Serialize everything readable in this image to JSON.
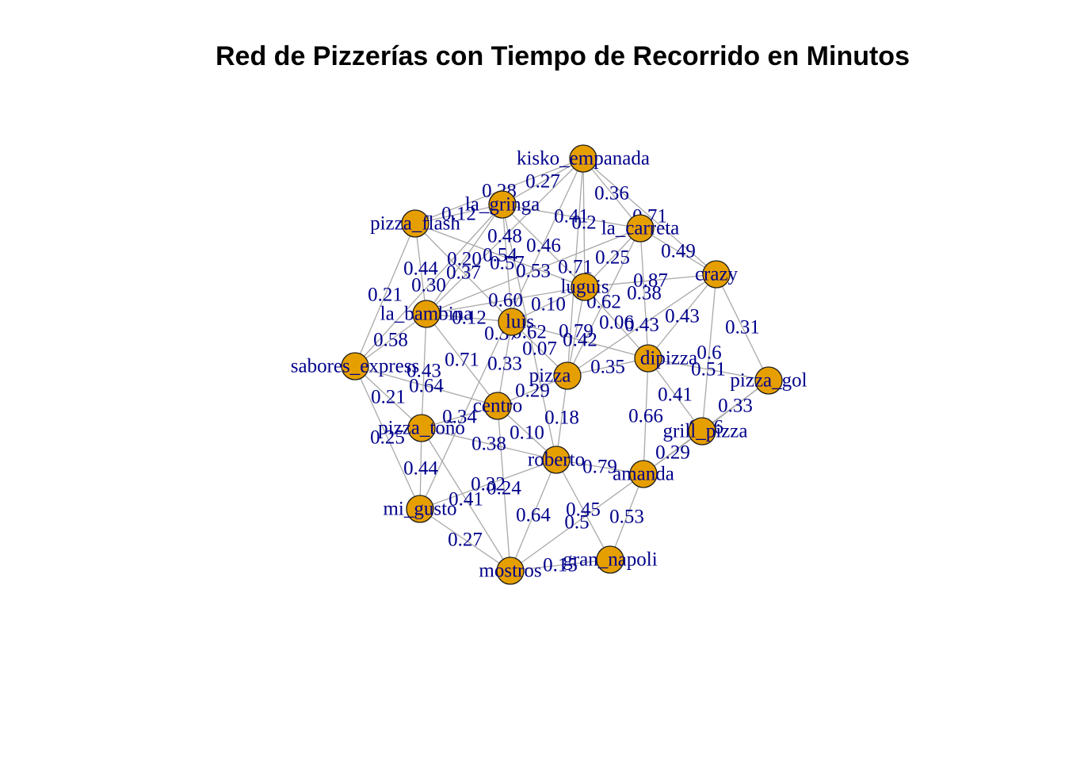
{
  "title": "Red de Pizzerías con Tiempo de Recorrido en Minutos",
  "colors": {
    "node_fill": "#e69f00",
    "edge": "#a9a9a9",
    "label": "#00008b"
  },
  "graph": {
    "nodes": [
      {
        "id": "kisko_empanada",
        "label": "kisko_empanada"
      },
      {
        "id": "la_gringa",
        "label": "la_gringa"
      },
      {
        "id": "la_carreta",
        "label": "la_carreta"
      },
      {
        "id": "pizza_flash",
        "label": "pizza_flash"
      },
      {
        "id": "crazy",
        "label": "crazy"
      },
      {
        "id": "luguis",
        "label": "luguis"
      },
      {
        "id": "la_bambina",
        "label": "la_bambina"
      },
      {
        "id": "luis",
        "label": "luis"
      },
      {
        "id": "sabores_express",
        "label": "sabores_express"
      },
      {
        "id": "dipizza",
        "label": "dipizza"
      },
      {
        "id": "pizza_center",
        "label": "pizza"
      },
      {
        "id": "pizza_gol",
        "label": "pizza_gol"
      },
      {
        "id": "centro",
        "label": "centro"
      },
      {
        "id": "pizza_toño",
        "label": "pizza_toño"
      },
      {
        "id": "grill_pizza",
        "label": "grill_pizza"
      },
      {
        "id": "roberto",
        "label": "roberto"
      },
      {
        "id": "amanda",
        "label": "amanda"
      },
      {
        "id": "mi_gusto",
        "label": "mi_gusto"
      },
      {
        "id": "gran_napoli",
        "label": "gran_napoli"
      },
      {
        "id": "mostros",
        "label": "mostros"
      }
    ],
    "edges": [
      {
        "from": "kisko_empanada",
        "to": "la_gringa",
        "weight": "0.27"
      },
      {
        "from": "kisko_empanada",
        "to": "pizza_flash",
        "weight": "0.28"
      },
      {
        "from": "kisko_empanada",
        "to": "luguis",
        "weight": "0.2"
      },
      {
        "from": "kisko_empanada",
        "to": "la_carreta",
        "weight": "0.36"
      },
      {
        "from": "kisko_empanada",
        "to": "la_bambina",
        "weight": "0.48"
      },
      {
        "from": "kisko_empanada",
        "to": "crazy",
        "weight": "0.71"
      },
      {
        "from": "kisko_empanada",
        "to": "pizza_center",
        "weight": "0.71"
      },
      {
        "from": "kisko_empanada",
        "to": "mi_gusto",
        "weight": "0.37"
      },
      {
        "from": "la_gringa",
        "to": "pizza_flash",
        "weight": "0.12"
      },
      {
        "from": "la_gringa",
        "to": "luguis",
        "weight": "0.46"
      },
      {
        "from": "la_gringa",
        "to": "la_carreta",
        "weight": "0.41"
      },
      {
        "from": "la_gringa",
        "to": "luis",
        "weight": "0.57"
      },
      {
        "from": "la_gringa",
        "to": "sabores_express",
        "weight": "0.30"
      },
      {
        "from": "la_gringa",
        "to": "la_bambina",
        "weight": "0.20"
      },
      {
        "from": "la_gringa",
        "to": "roberto",
        "weight": "0.62"
      },
      {
        "from": "la_carreta",
        "to": "crazy",
        "weight": "0.49"
      },
      {
        "from": "la_carreta",
        "to": "luguis",
        "weight": "0.25"
      },
      {
        "from": "la_carreta",
        "to": "dipizza",
        "weight": "0.38"
      },
      {
        "from": "la_carreta",
        "to": "pizza_center",
        "weight": "0.62"
      },
      {
        "from": "la_carreta",
        "to": "la_bambina",
        "weight": "0.53"
      },
      {
        "from": "pizza_flash",
        "to": "la_bambina",
        "weight": "0.44"
      },
      {
        "from": "pizza_flash",
        "to": "sabores_express",
        "weight": "0.21"
      },
      {
        "from": "pizza_flash",
        "to": "luis",
        "weight": "0.37"
      },
      {
        "from": "pizza_flash",
        "to": "luguis",
        "weight": "0.54"
      },
      {
        "from": "crazy",
        "to": "pizza_gol",
        "weight": "0.31"
      },
      {
        "from": "crazy",
        "to": "dipizza",
        "weight": "0.43"
      },
      {
        "from": "crazy",
        "to": "luguis",
        "weight": "0.87"
      },
      {
        "from": "crazy",
        "to": "grill_pizza",
        "weight": "0.6"
      },
      {
        "from": "crazy",
        "to": "pizza_center",
        "weight": "0.43"
      },
      {
        "from": "luguis",
        "to": "luis",
        "weight": "0.10"
      },
      {
        "from": "luguis",
        "to": "dipizza",
        "weight": "0.06"
      },
      {
        "from": "luguis",
        "to": "pizza_center",
        "weight": "0.79"
      },
      {
        "from": "luguis",
        "to": "la_bambina",
        "weight": "0.60"
      },
      {
        "from": "la_bambina",
        "to": "sabores_express",
        "weight": "0.58"
      },
      {
        "from": "la_bambina",
        "to": "luis",
        "weight": "0.12"
      },
      {
        "from": "la_bambina",
        "to": "pizza_toño",
        "weight": "0.43"
      },
      {
        "from": "la_bambina",
        "to": "centro",
        "weight": "0.71"
      },
      {
        "from": "luis",
        "to": "pizza_center",
        "weight": "0.07"
      },
      {
        "from": "luis",
        "to": "centro",
        "weight": "0.33"
      },
      {
        "from": "luis",
        "to": "dipizza",
        "weight": "0.42"
      },
      {
        "from": "sabores_express",
        "to": "pizza_toño",
        "weight": "0.21"
      },
      {
        "from": "sabores_express",
        "to": "mi_gusto",
        "weight": "0.25"
      },
      {
        "from": "sabores_express",
        "to": "centro",
        "weight": "0.64"
      },
      {
        "from": "dipizza",
        "to": "pizza_gol",
        "weight": "0.51"
      },
      {
        "from": "dipizza",
        "to": "grill_pizza",
        "weight": "0.41"
      },
      {
        "from": "dipizza",
        "to": "pizza_center",
        "weight": "0.35"
      },
      {
        "from": "dipizza",
        "to": "amanda",
        "weight": "0.66"
      },
      {
        "from": "pizza_gol",
        "to": "grill_pizza",
        "weight": "0.33"
      },
      {
        "from": "pizza_gol",
        "to": "amanda",
        "weight": "0.16"
      },
      {
        "from": "pizza_center",
        "to": "centro",
        "weight": "0.29"
      },
      {
        "from": "pizza_center",
        "to": "roberto",
        "weight": "0.18"
      },
      {
        "from": "centro",
        "to": "pizza_toño",
        "weight": "0.34"
      },
      {
        "from": "centro",
        "to": "roberto",
        "weight": "0.10"
      },
      {
        "from": "pizza_toño",
        "to": "mi_gusto",
        "weight": "0.44"
      },
      {
        "from": "pizza_toño",
        "to": "roberto",
        "weight": "0.38"
      },
      {
        "from": "grill_pizza",
        "to": "amanda",
        "weight": "0.29"
      },
      {
        "from": "roberto",
        "to": "amanda",
        "weight": "0.79"
      },
      {
        "from": "roberto",
        "to": "gran_napoli",
        "weight": "0.45"
      },
      {
        "from": "roberto",
        "to": "mostros",
        "weight": "0.64"
      },
      {
        "from": "amanda",
        "to": "gran_napoli",
        "weight": "0.53"
      },
      {
        "from": "mi_gusto",
        "to": "mostros",
        "weight": "0.27"
      },
      {
        "from": "mi_gusto",
        "to": "roberto",
        "weight": "0.32"
      },
      {
        "from": "gran_napoli",
        "to": "mostros",
        "weight": "0.15"
      },
      {
        "from": "mostros",
        "to": "centro",
        "weight": "0.24"
      },
      {
        "from": "mostros",
        "to": "amanda",
        "weight": "0.5"
      },
      {
        "from": "mostros",
        "to": "pizza_toño",
        "weight": "0.41"
      }
    ]
  }
}
